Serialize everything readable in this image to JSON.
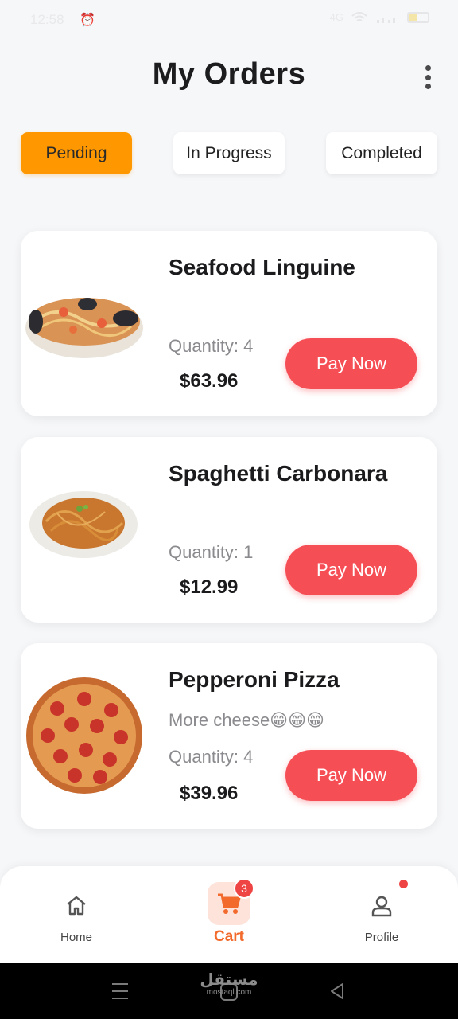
{
  "status_bar": {
    "time": "12:58",
    "alarm_icon": "alarm-icon",
    "network": "4G",
    "signal": "signal-icon",
    "battery": "battery-icon"
  },
  "header": {
    "title": "My Orders",
    "menu_icon": "more-vertical-icon"
  },
  "tabs": [
    {
      "label": "Pending",
      "active": true
    },
    {
      "label": "In Progress",
      "active": false
    },
    {
      "label": "Completed",
      "active": false
    }
  ],
  "orders": [
    {
      "name": "Seafood Linguine",
      "note": "",
      "quantity": "Quantity: 4",
      "price": "$63.96",
      "action": "Pay Now",
      "image": "seafood-linguine"
    },
    {
      "name": "Spaghetti Carbonara",
      "note": "",
      "quantity": "Quantity: 1",
      "price": "$12.99",
      "action": "Pay Now",
      "image": "spaghetti-carbonara"
    },
    {
      "name": "Pepperoni Pizza",
      "note": "More cheese😁😁😁",
      "quantity": "Quantity: 4",
      "price": "$39.96",
      "action": "Pay Now",
      "image": "pepperoni-pizza"
    }
  ],
  "bottom_nav": {
    "items": [
      {
        "label": "Home",
        "icon": "home-icon",
        "active": false
      },
      {
        "label": "Cart",
        "icon": "cart-icon",
        "active": true,
        "badge": "3"
      },
      {
        "label": "Profile",
        "icon": "profile-icon",
        "active": false,
        "dot": true
      }
    ]
  },
  "colors": {
    "accent": "#ff9800",
    "pay": "#f64e55",
    "cart_active": "#f26a2c",
    "badge": "#ef4444"
  },
  "watermark": {
    "arabic": "مستقل",
    "domain": "mostaql.com"
  }
}
